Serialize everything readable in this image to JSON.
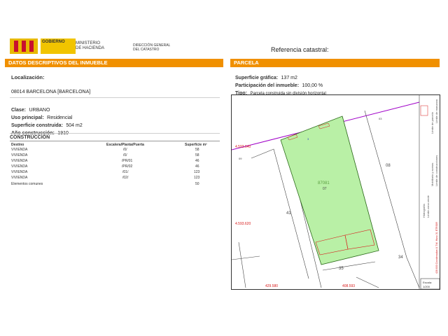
{
  "header": {
    "ministry_bar_text": "GOBIERNO",
    "ministry_line1": "MINISTERIO",
    "ministry_line2": "DE HACIENDA",
    "dg_line1": "DIRECCIÓN GENERAL",
    "dg_line2": "DEL CATASTRO",
    "ref_catastral_label": "Referencia catastral:"
  },
  "left_section": {
    "title": "DATOS DESCRIPTIVOS DEL INMUEBLE",
    "localizacion_label": "Localización:",
    "address": "08014 BARCELONA [BARCELONA]",
    "clase_label": "Clase:",
    "clase_value": "URBANO",
    "uso_label": "Uso principal:",
    "uso_value": "Residencial",
    "superficie_label": "Superficie construida:",
    "superficie_value": "504 m2",
    "anio_label": "Año construcción:",
    "anio_value": "1910",
    "construccion_title": "CONSTRUCCIÓN",
    "table": {
      "headers": [
        "Destino",
        "Escalera/Planta/Puerta",
        "Superficie m²"
      ],
      "rows": [
        [
          "VIVIENDA",
          "/0/",
          "58"
        ],
        [
          "VIVIENDA",
          "/0/",
          "58"
        ],
        [
          "VIVIENDA",
          "/PR/01",
          "46"
        ],
        [
          "VIVIENDA",
          "/PR/02",
          "46"
        ],
        [
          "VIVIENDA",
          "/01/",
          "123"
        ],
        [
          "VIVIENDA",
          "/02/",
          "123"
        ],
        [
          "Elementos comunes",
          "",
          "50"
        ]
      ]
    }
  },
  "right_section": {
    "title": "PARCELA",
    "sup_grafica_label": "Superficie gráfica:",
    "sup_grafica_value": "137 m2",
    "participacion_label": "Participación del inmueble:",
    "participacion_value": "100,00 %",
    "tipo_label": "Tipo:",
    "tipo_value": "Parcela construida sin división horizontal",
    "map": {
      "parcel_ref": "87081",
      "parcel_num": "07",
      "labels": {
        "n41": "41",
        "n35": "35",
        "n34": "34",
        "n08": "08",
        "n09": "09",
        "n03": "03"
      },
      "coords": {
        "top_y": "4.593.640",
        "mid_y": "4.593.620",
        "bottom_x1": "429.580",
        "bottom_x2": "408.593"
      },
      "street_num": "3",
      "legend": [
        "Límite de manzana",
        "Límite de parcela",
        "Límite de construcciones",
        "Mobiliario y aceras",
        "Límite zona verde",
        "Hidrografía"
      ],
      "scale_label": "Escala:",
      "scale_value": "1/200",
      "projection_note": "428.600 Coordenadas U.T.M. Huso 31 ETRS89",
      "colors": {
        "parcel_fill": "#b9f0a6",
        "parcel_line": "#2c6b1a",
        "street_line": "#a000c8",
        "red_line": "#d81b1b"
      }
    }
  }
}
